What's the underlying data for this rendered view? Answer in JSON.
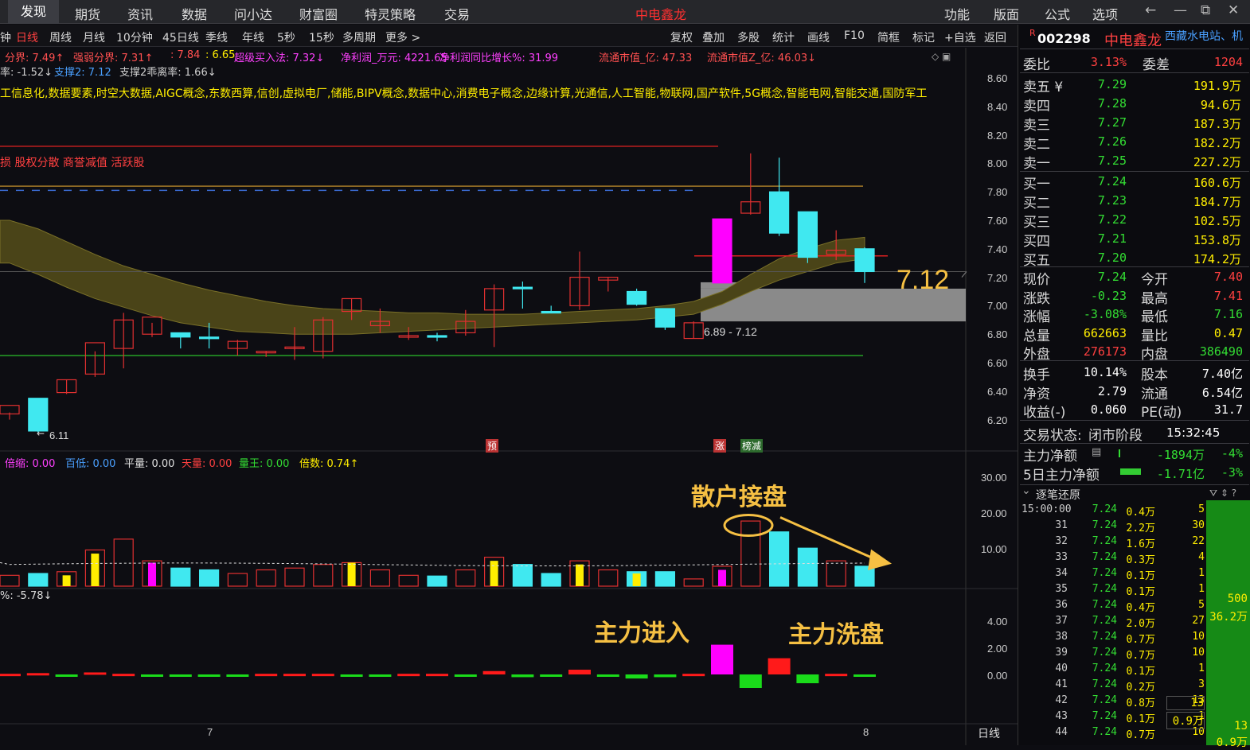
{
  "topnav": {
    "items": [
      "发现",
      "期货",
      "资讯",
      "数据",
      "问小达",
      "财富圈",
      "特灵策略",
      "交易"
    ],
    "title": "中电鑫龙",
    "right": [
      "功能",
      "版面",
      "公式",
      "选项"
    ],
    "controls": [
      "←",
      "—",
      "⧉",
      "✕"
    ]
  },
  "toolbar": {
    "left": [
      "日线",
      "周线",
      "月线",
      "10分钟",
      "45日线",
      "季线",
      "年线",
      "5秒",
      "15秒",
      "多周期",
      "更多 >"
    ],
    "right": [
      "复权",
      "叠加",
      "多股",
      "统计",
      "画线",
      "F10",
      "简框",
      "标记",
      "+自选",
      "返回"
    ],
    "cut": "钟"
  },
  "indicators": {
    "row1": [
      {
        "t": "分界: 7.49↑",
        "c": "#ff5050"
      },
      {
        "t": "强弱分界: 7.31↑",
        "c": "#ff5050"
      },
      {
        "t": ": 7.84",
        "c": "#ff5050"
      },
      {
        "t": ": 6.65",
        "c": "#ffee00"
      },
      {
        "t": "超级买入法: 7.32↓",
        "c": "#ff40ff"
      },
      {
        "t": "净利润_万元: 4221.65",
        "c": "#ff40ff"
      },
      {
        "t": "净利润同比增长%: 31.99",
        "c": "#ff40ff"
      },
      {
        "t": "流通市值_亿: 47.33",
        "c": "#ff5050"
      },
      {
        "t": "流通市值Z_亿: 46.03↓",
        "c": "#ff5050"
      }
    ],
    "concepts": "工信息化,数据要素,时空大数据,AIGC概念,东数西算,信创,虚拟电厂,储能,BIPV概念,数据中心,消费电子概念,边缘计算,光通信,人工智能,物联网,国产软件,5G概念,智能电网,智能交通,国防军工",
    "tags": "损 股权分散 商誉减值 活跃股",
    "row4": [
      {
        "t": "率: -1.52↓",
        "c": "#cfcfcf"
      },
      {
        "t": "支撑2: 7.12",
        "c": "#4aa0ff"
      },
      {
        "t": "支撑2乖离率: 1.66↓",
        "c": "#cfcfcf"
      }
    ],
    "vol": [
      {
        "t": "倍缩: 0.00",
        "c": "#ff40ff"
      },
      {
        "t": "百低: 0.00",
        "c": "#4aa0ff"
      },
      {
        "t": "平量: 0.00",
        "c": "#e0e0e0"
      },
      {
        "t": "天量: 0.00",
        "c": "#ff4040"
      },
      {
        "t": "量王: 0.00",
        "c": "#33dd33"
      },
      {
        "t": "倍数: 0.74↑",
        "c": "#ffee00"
      }
    ],
    "mf": "%: -5.78↓"
  },
  "chart": {
    "price_axis": [
      "8.60",
      "8.40",
      "8.20",
      "8.00",
      "7.80",
      "7.60",
      "7.40",
      "7.20",
      "7.00",
      "6.80",
      "6.60",
      "6.40",
      "6.20"
    ],
    "vol_axis": [
      "30.00",
      "20.00",
      "10.00"
    ],
    "mf_axis": [
      "4.00",
      "2.00",
      "0.00"
    ],
    "low_marker": "6.11",
    "range_label": "6.89 - 7.12",
    "big_price": "7.12",
    "flag_yu": "预",
    "flag_zhang": "涨",
    "flag_bang": "榜减",
    "date_7": "7",
    "date_8": "8",
    "period": "日线",
    "ann_retail": "散户接盘",
    "ann_enter": "主力进入",
    "ann_wash": "主力洗盘"
  },
  "chart_data": {
    "type": "candlestick",
    "candles": [
      [
        6.24,
        6.3,
        6.2,
        6.25
      ],
      [
        6.35,
        6.12,
        6.11,
        6.12
      ],
      [
        6.39,
        6.48,
        6.38,
        6.48
      ],
      [
        6.52,
        6.74,
        6.5,
        6.68
      ],
      [
        6.7,
        6.9,
        6.56,
        6.95
      ],
      [
        6.8,
        6.92,
        6.78,
        6.88
      ],
      [
        6.81,
        6.78,
        6.7,
        6.8
      ],
      [
        6.78,
        6.77,
        6.7,
        6.88
      ],
      [
        6.7,
        6.75,
        6.65,
        6.76
      ],
      [
        6.68,
        6.68,
        6.64,
        6.68
      ],
      [
        6.7,
        6.71,
        6.62,
        6.85
      ],
      [
        6.68,
        6.9,
        6.63,
        6.92
      ],
      [
        6.96,
        7.05,
        6.9,
        7.05
      ],
      [
        6.86,
        6.89,
        6.81,
        6.98
      ],
      [
        6.79,
        6.79,
        6.76,
        6.85
      ],
      [
        6.79,
        6.78,
        6.75,
        6.81
      ],
      [
        6.81,
        6.89,
        6.79,
        6.97
      ],
      [
        6.97,
        7.12,
        6.71,
        7.15
      ],
      [
        7.13,
        7.12,
        6.98,
        7.17
      ],
      [
        6.96,
        6.95,
        6.95,
        7.0
      ],
      [
        7.0,
        7.2,
        6.97,
        7.38
      ],
      [
        7.18,
        7.2,
        7.1,
        7.2
      ],
      [
        7.1,
        7.01,
        7.0,
        7.12
      ],
      [
        6.98,
        6.85,
        6.83,
        6.9
      ],
      [
        6.77,
        6.88,
        6.77,
        6.89
      ],
      [
        7.16,
        7.61,
        7.16,
        7.61
      ],
      [
        7.65,
        7.73,
        7.64,
        8.07
      ],
      [
        7.8,
        7.51,
        7.49,
        8.04
      ],
      [
        7.66,
        7.34,
        7.3,
        7.66
      ],
      [
        7.36,
        7.39,
        7.32,
        7.53
      ],
      [
        7.4,
        7.24,
        7.16,
        7.41
      ]
    ],
    "volume_wan": [
      3,
      3.5,
      4,
      10,
      13,
      7,
      5,
      4.5,
      3.5,
      4.5,
      5,
      6,
      6.5,
      4.5,
      3,
      2.8,
      4.5,
      8,
      6,
      3.5,
      7,
      4.5,
      4,
      4,
      2,
      5.5,
      18,
      15,
      10.5,
      7,
      5.5
    ],
    "volume_prev_overlay_wan": [
      0,
      0,
      3,
      9,
      0,
      6.5,
      0,
      0,
      0,
      0,
      0,
      0,
      6.5,
      0,
      0,
      0,
      0,
      7,
      0,
      0,
      6,
      0,
      3.5,
      0,
      0,
      4.5,
      0,
      0,
      0,
      0,
      0
    ],
    "money_flow": [
      0.05,
      0.1,
      -0.1,
      0.15,
      0.05,
      -0.15,
      -0.1,
      -0.15,
      -0.1,
      0.05,
      0.05,
      0.05,
      -0.05,
      -0.05,
      0.05,
      0.05,
      -0.05,
      0.25,
      -0.2,
      -0.15,
      0.35,
      -0.05,
      -0.3,
      -0.2,
      0.05,
      2.2,
      -1.0,
      1.2,
      -0.65,
      0.05,
      -0.15
    ],
    "price_range": [
      6.1,
      8.7
    ],
    "volume_range": [
      0,
      32
    ],
    "money_flow_range": [
      -1.3,
      4.6
    ],
    "levels": {
      "red": 8.12,
      "orange": 7.84,
      "blue_dash": 7.81,
      "green": 6.65,
      "support_band": [
        6.89,
        7.12
      ],
      "red_short": 7.35
    }
  },
  "quote": {
    "code": "002298",
    "name": "中电鑫龙",
    "badge": "R",
    "concept": "西藏水电站、机",
    "wb_label": "委比",
    "wb": "3.13%",
    "wc_label": "委差",
    "wc": "1204",
    "asks": [
      {
        "l": "卖五 ¥",
        "p": "7.29",
        "v": "191.9万"
      },
      {
        "l": "卖四",
        "p": "7.28",
        "v": "94.6万"
      },
      {
        "l": "卖三",
        "p": "7.27",
        "v": "187.3万"
      },
      {
        "l": "卖二",
        "p": "7.26",
        "v": "182.2万"
      },
      {
        "l": "卖一",
        "p": "7.25",
        "v": "227.2万"
      }
    ],
    "bids": [
      {
        "l": "买一",
        "p": "7.24",
        "v": "160.6万"
      },
      {
        "l": "买二",
        "p": "7.23",
        "v": "184.7万"
      },
      {
        "l": "买三",
        "p": "7.22",
        "v": "102.5万"
      },
      {
        "l": "买四",
        "p": "7.21",
        "v": "153.8万"
      },
      {
        "l": "买五",
        "p": "7.20",
        "v": "174.2万"
      }
    ],
    "stats": [
      {
        "l": "现价",
        "v": "7.24",
        "c": "#33dd33",
        "l2": "今开",
        "v2": "7.40",
        "c2": "#ff4040"
      },
      {
        "l": "涨跌",
        "v": "-0.23",
        "c": "#33dd33",
        "l2": "最高",
        "v2": "7.41",
        "c2": "#ff4040"
      },
      {
        "l": "涨幅",
        "v": "-3.08%",
        "c": "#33dd33",
        "l2": "最低",
        "v2": "7.16",
        "c2": "#33dd33"
      },
      {
        "l": "总量",
        "v": "662663",
        "c": "#ffee00",
        "l2": "量比",
        "v2": "0.47",
        "c2": "#ffee00"
      },
      {
        "l": "外盘",
        "v": "276173",
        "c": "#ff4040",
        "l2": "内盘",
        "v2": "386490",
        "c2": "#33dd33"
      }
    ],
    "stats2": [
      {
        "l": "换手",
        "v": "10.14%",
        "l2": "股本",
        "v2": "7.40亿"
      },
      {
        "l": "净资",
        "v": "2.79",
        "l2": "流通",
        "v2": "6.54亿"
      },
      {
        "l": "收益(-)",
        "v": "0.060",
        "l2": "PE(动)",
        "v2": "31.7"
      }
    ],
    "status_label": "交易状态:",
    "status": "闭市阶段",
    "time": "15:32:45",
    "flow1_label": "主力净额",
    "flow1": "-1894万",
    "flow1p": "-4%",
    "flow2_label": "5日主力净额",
    "flow2": "-1.71亿",
    "flow2p": "-3%",
    "ticks_title": "逐笔还原",
    "ticks": [
      [
        "15:00:00",
        "7.24",
        "0.4万",
        "5"
      ],
      [
        "31",
        "7.24",
        "2.2万",
        "30"
      ],
      [
        "32",
        "7.24",
        "1.6万",
        "22"
      ],
      [
        "33",
        "7.24",
        "0.3万",
        "4"
      ],
      [
        "34",
        "7.24",
        "0.1万",
        "1"
      ],
      [
        "35",
        "7.24",
        "0.1万",
        "1"
      ],
      [
        "36",
        "7.24",
        "0.4万",
        "5"
      ],
      [
        "37",
        "7.24",
        "2.0万",
        "27"
      ],
      [
        "38",
        "7.24",
        "0.7万",
        "10"
      ],
      [
        "39",
        "7.24",
        "0.7万",
        "10"
      ],
      [
        "40",
        "7.24",
        "0.1万",
        "1"
      ],
      [
        "41",
        "7.24",
        "0.2万",
        "3"
      ],
      [
        "42",
        "7.24",
        "0.8万",
        "13"
      ],
      [
        "43",
        "7.24",
        "0.1万",
        "1"
      ],
      [
        "44",
        "7.24",
        "0.7万",
        "10"
      ]
    ],
    "side_500": "500",
    "side_362": "36.2万",
    "side_13": "13",
    "side_09": "0.9万",
    "side_13b": "13",
    "side_09b": "0.9万"
  }
}
